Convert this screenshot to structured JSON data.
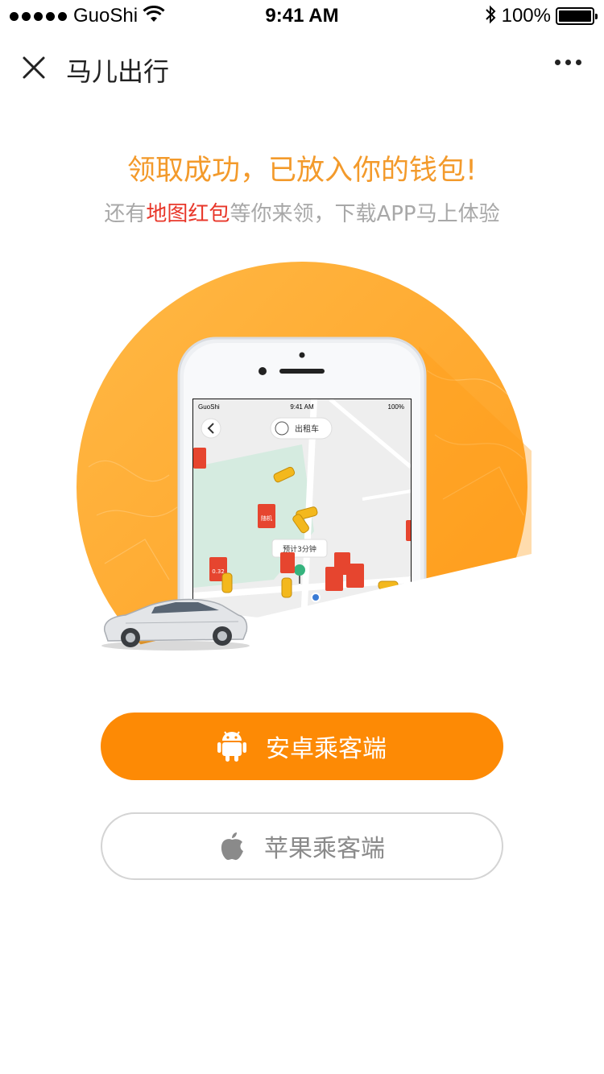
{
  "status_bar": {
    "carrier": "GuoShi",
    "time": "9:41 AM",
    "battery": "100%"
  },
  "nav": {
    "title": "马儿出行",
    "close_icon": "close-icon",
    "more_icon": "more-dots-icon"
  },
  "headline": "领取成功，已放入你的钱包!",
  "subline": {
    "prefix": "还有",
    "highlight": "地图红包",
    "suffix": "等你来领，下载APP马上体验"
  },
  "illustration": {
    "phone_status": {
      "carrier": "GuoShi",
      "time": "9:41 AM",
      "battery": "100%"
    },
    "service_selector": "出租车",
    "eta_bubble": "预计3分钟",
    "red_packet_label": "随机",
    "red_packet_amount": "0.32"
  },
  "buttons": {
    "android": {
      "label": "安卓乘客端",
      "icon": "android-icon"
    },
    "apple": {
      "label": "苹果乘客端",
      "icon": "apple-icon"
    }
  },
  "colors": {
    "accent": "#fd8a05",
    "headline": "#f39a2b",
    "highlight": "#e8372a",
    "circle": "#ffac30"
  }
}
